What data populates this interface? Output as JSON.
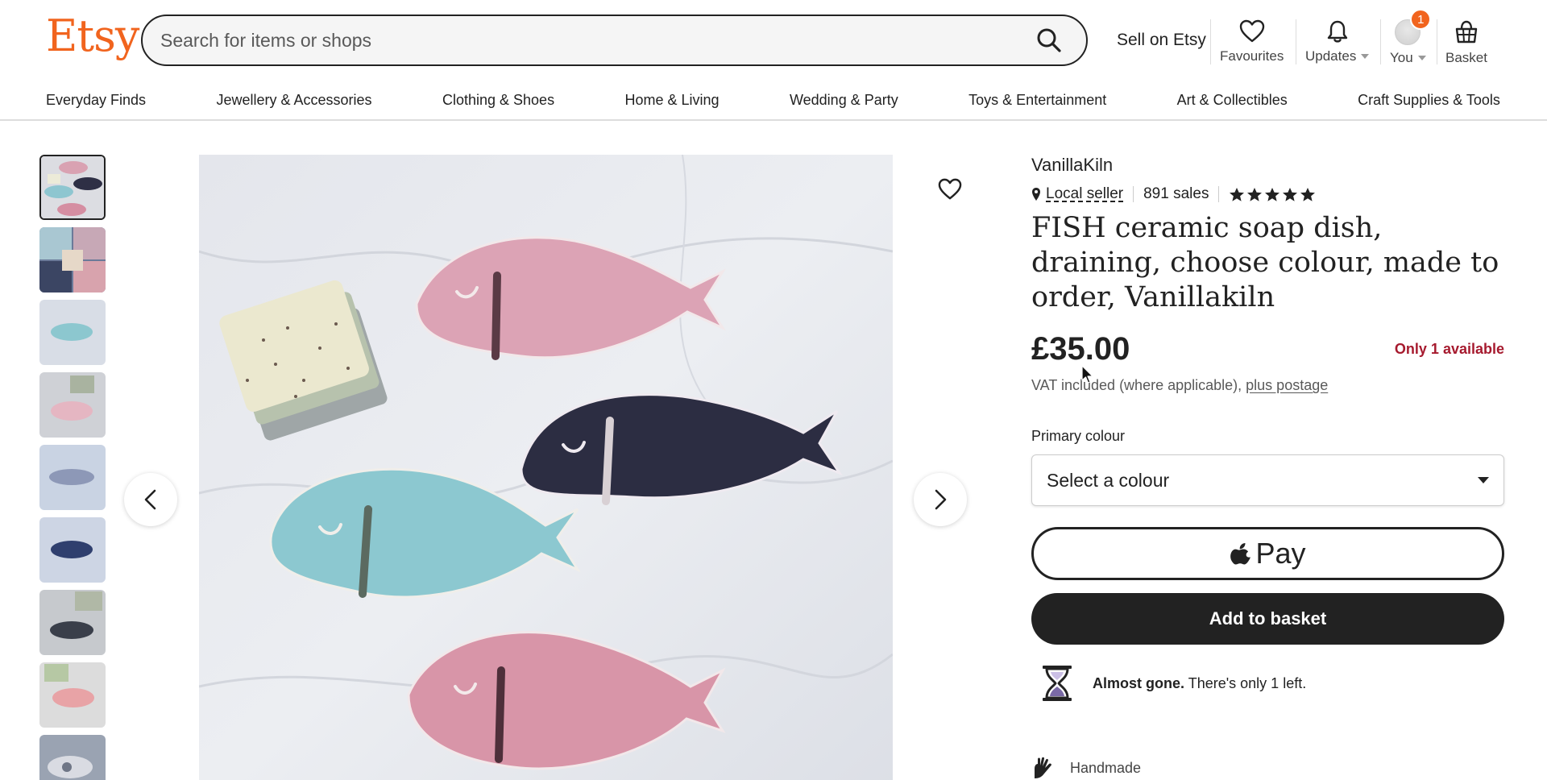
{
  "header": {
    "logo": "Etsy",
    "search_placeholder": "Search for items or shops",
    "sell_link": "Sell on Etsy",
    "favourites_label": "Favourites",
    "updates_label": "Updates",
    "you_label": "You",
    "notification_count": "1",
    "basket_label": "Basket"
  },
  "categories": [
    "Everyday Finds",
    "Jewellery & Accessories",
    "Clothing & Shoes",
    "Home & Living",
    "Wedding & Party",
    "Toys & Entertainment",
    "Art & Collectibles",
    "Craft Supplies & Tools"
  ],
  "gallery": {
    "thumbnail_count": 9,
    "selected_index": 0
  },
  "listing": {
    "shop_name": "VanillaKiln",
    "local_seller": "Local seller",
    "sales": "891 sales",
    "rating_stars": 5,
    "title": "FISH ceramic soap dish, draining, choose colour, made to order, Vanillakiln",
    "price": "£35.00",
    "availability": "Only 1 available",
    "vat_text": "VAT included (where applicable),",
    "postage_link": "plus postage",
    "option_label": "Primary colour",
    "option_value": "Select a colour",
    "applepay_label": "Pay",
    "add_to_basket": "Add to basket",
    "almost_gone_bold": "Almost gone.",
    "almost_gone_text": "There's only 1 left.",
    "handmade": "Handmade"
  },
  "colors": {
    "brand": "#F1641E",
    "availability": "#A61A2E",
    "button_dark": "#222222"
  }
}
